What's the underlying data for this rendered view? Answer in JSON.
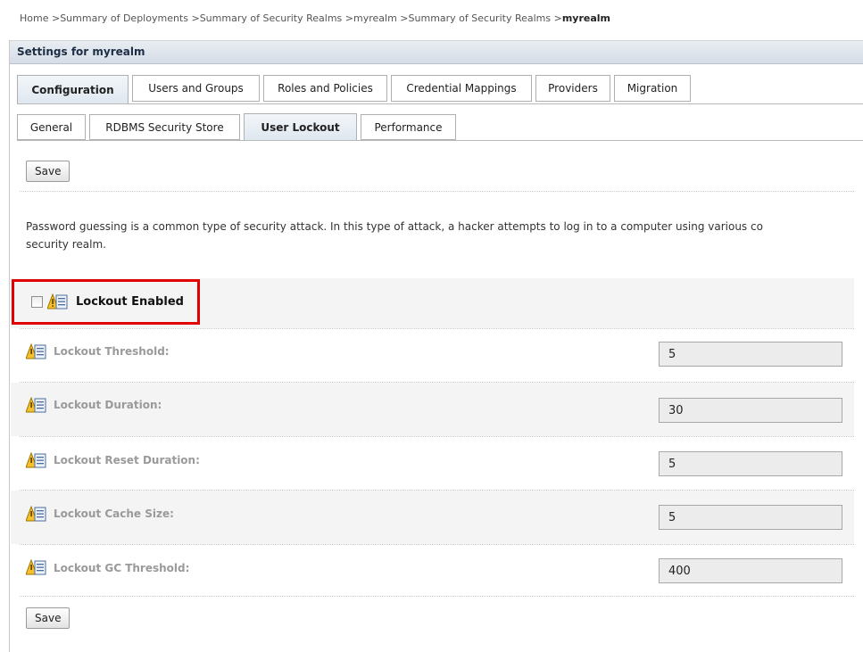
{
  "breadcrumb": {
    "items": [
      "Home",
      "Summary of Deployments",
      "Summary of Security Realms",
      "myrealm",
      "Summary of Security Realms"
    ],
    "current": "myrealm",
    "separator": " >"
  },
  "settings": {
    "title": "Settings for myrealm"
  },
  "tabs_main": [
    {
      "label": "Configuration",
      "active": true
    },
    {
      "label": "Users and Groups",
      "active": false
    },
    {
      "label": "Roles and Policies",
      "active": false
    },
    {
      "label": "Credential Mappings",
      "active": false
    },
    {
      "label": "Providers",
      "active": false
    },
    {
      "label": "Migration",
      "active": false
    }
  ],
  "tabs_sub": [
    {
      "label": "General",
      "active": false
    },
    {
      "label": "RDBMS Security Store",
      "active": false
    },
    {
      "label": "User Lockout",
      "active": true
    },
    {
      "label": "Performance",
      "active": false
    }
  ],
  "buttons": {
    "save_top": "Save",
    "save_bottom": "Save"
  },
  "description": {
    "line1": "Password guessing is a common type of security attack. In this type of attack, a hacker attempts to log in to a computer using various co",
    "line2": "security realm."
  },
  "lockout_enabled": {
    "label": "Lockout Enabled",
    "checked": false
  },
  "fields": [
    {
      "label": "Lockout Threshold:",
      "value": "5"
    },
    {
      "label": "Lockout Duration:",
      "value": "30"
    },
    {
      "label": "Lockout Reset Duration:",
      "value": "5"
    },
    {
      "label": "Lockout Cache Size:",
      "value": "5"
    },
    {
      "label": "Lockout GC Threshold:",
      "value": "400"
    }
  ],
  "icons": {
    "field_icon": "warning-info-icon"
  },
  "colors": {
    "highlight_border": "#e20000",
    "header_bg": "#dfe7ef"
  }
}
